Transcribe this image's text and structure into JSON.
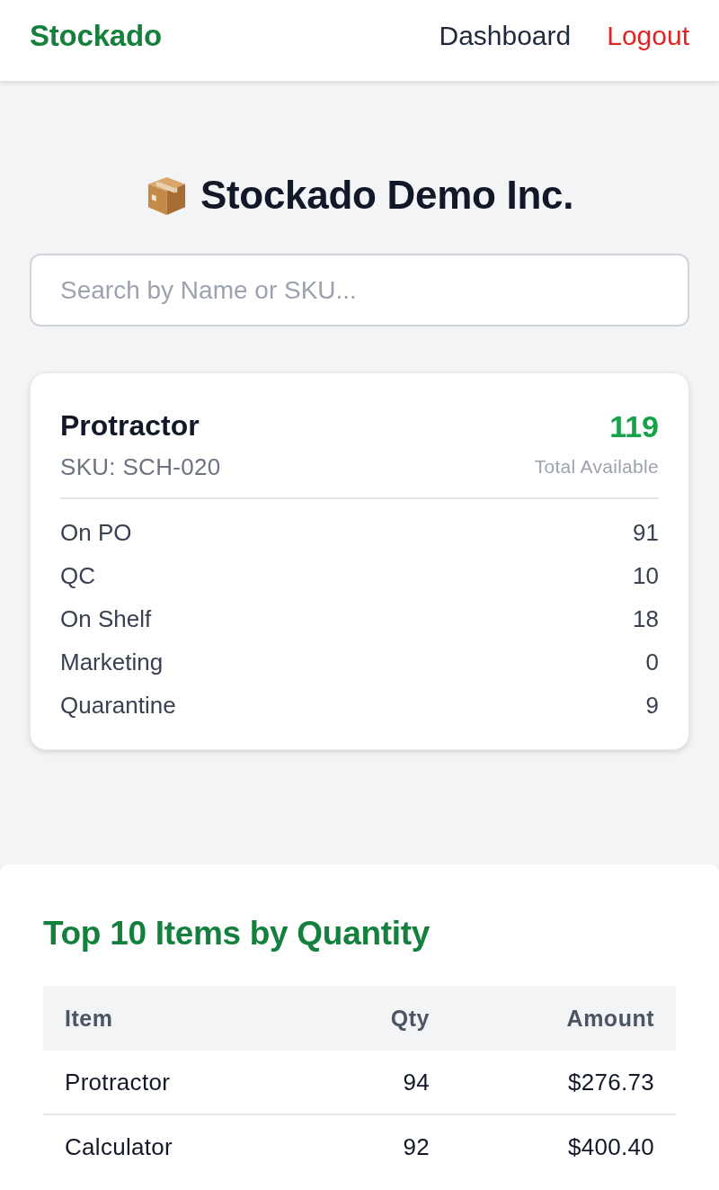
{
  "header": {
    "brand": "Stockado",
    "nav": [
      {
        "label": "Dashboard",
        "kind": "link"
      },
      {
        "label": "Logout",
        "kind": "danger"
      }
    ]
  },
  "title": {
    "text": "Stockado Demo Inc."
  },
  "search": {
    "placeholder": "Search by Name or SKU..."
  },
  "item_card": {
    "name": "Protractor",
    "sku": "SKU: SCH-020",
    "total": "119",
    "total_label": "Total Available",
    "locations": [
      {
        "label": "On PO",
        "value": "91"
      },
      {
        "label": "QC",
        "value": "10"
      },
      {
        "label": "On Shelf",
        "value": "18"
      },
      {
        "label": "Marketing",
        "value": "0"
      },
      {
        "label": "Quarantine",
        "value": "9"
      }
    ]
  },
  "top_items": {
    "heading": "Top 10 Items by Quantity",
    "columns": [
      "Item",
      "Qty",
      "Amount"
    ],
    "rows": [
      [
        "Protractor",
        "94",
        "$276.73"
      ],
      [
        "Calculator",
        "92",
        "$400.40"
      ]
    ]
  }
}
